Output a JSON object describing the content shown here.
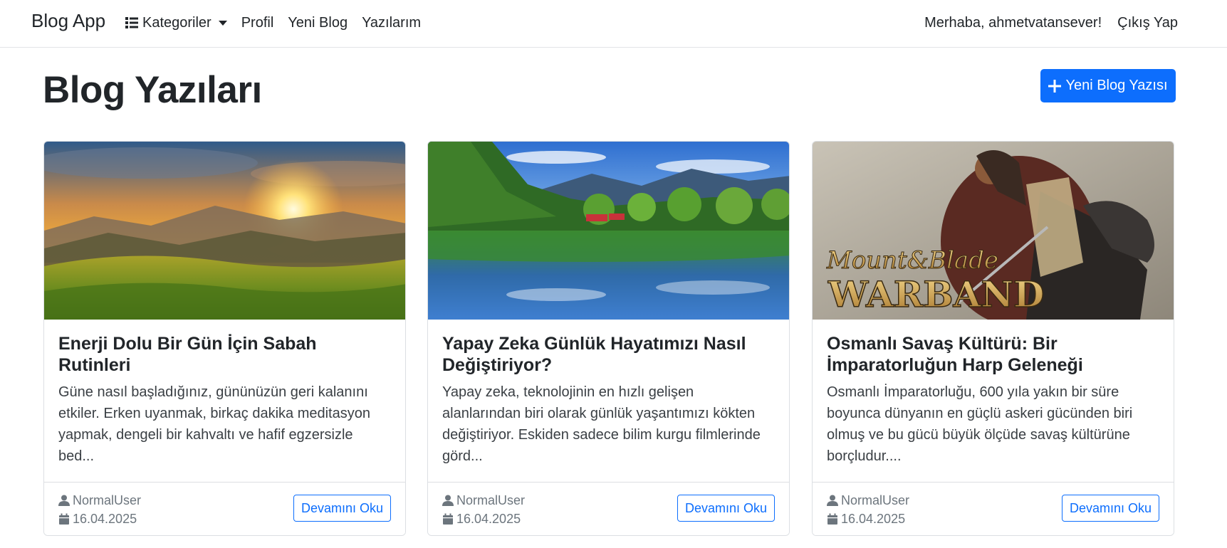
{
  "navbar": {
    "brand": "Blog App",
    "categories_label": "Kategoriler",
    "links": [
      "Profil",
      "Yeni Blog",
      "Yazılarım"
    ],
    "greeting": "Merhaba, ahmetvatansever!",
    "logout": "Çıkış Yap"
  },
  "page": {
    "title": "Blog Yazıları",
    "new_post_button": "Yeni Blog Yazısı"
  },
  "posts": [
    {
      "title": "Enerji Dolu Bir Gün İçin Sabah Rutinleri",
      "excerpt": "Güne nasıl başladığınız, gününüzün geri kalanını etkiler. Erken uyanmak, birkaç dakika meditasyon yapmak, dengeli bir kahvaltı ve hafif egzersizle bed...",
      "author": "NormalUser",
      "date": "16.04.2025",
      "button": "Devamını Oku",
      "image": "sunrise-meadow-image"
    },
    {
      "title": "Yapay Zeka Günlük Hayatımızı Nasıl Değiştiriyor?",
      "excerpt": "Yapay zeka, teknolojinin en hızlı gelişen alanlarından biri olarak günlük yaşantımızı kökten değiştiriyor. Eskiden sadece bilim kurgu filmlerinde görd...",
      "author": "NormalUser",
      "date": "16.04.2025",
      "button": "Devamını Oku",
      "image": "lake-forest-reflection-image"
    },
    {
      "title": "Osmanlı Savaş Kültürü: Bir İmparatorluğun Harp Geleneği",
      "excerpt": "Osmanlı İmparatorluğu, 600 yıla yakın bir süre boyunca dünyanın en güçlü askeri gücünden biri olmuş ve bu gücü büyük ölçüde savaş kültürüne borçludur....",
      "author": "NormalUser",
      "date": "16.04.2025",
      "button": "Devamını Oku",
      "image": "mount-and-blade-warband-image",
      "image_text": [
        "Mount&Blade",
        "WARBAND"
      ]
    }
  ],
  "icons": {
    "categories": "list-icon",
    "caret": "caret-down-icon",
    "new_post": "plus-icon",
    "author": "user-icon",
    "date": "calendar-icon"
  },
  "colors": {
    "primary": "#0d6efd",
    "text": "#212529",
    "muted": "#6c757d"
  }
}
